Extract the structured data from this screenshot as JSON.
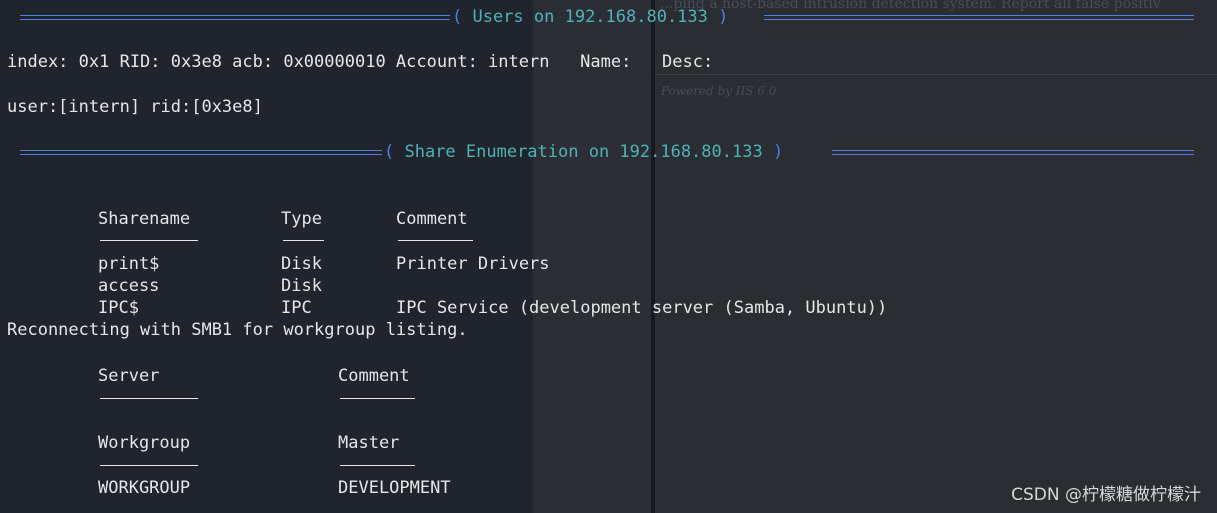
{
  "background_window": {
    "line1": "...ping a host-based intrusion detection system. Report all false positiv",
    "line2": "Powered by IIS 6.0"
  },
  "sections": {
    "users_heading": "Users on 192.168.80.133",
    "users_line": "index: 0x1 RID: 0x3e8 acb: 0x00000010 Account: intern   Name:   Desc:",
    "user_rid_line": "user:[intern] rid:[0x3e8]",
    "share_heading": "Share Enumeration on 192.168.80.133"
  },
  "share_table": {
    "headers": [
      "Sharename",
      "Type",
      "Comment"
    ],
    "rows": [
      {
        "sharename": "print$",
        "type": "Disk",
        "comment": "Printer Drivers"
      },
      {
        "sharename": "access",
        "type": "Disk",
        "comment": ""
      },
      {
        "sharename": "IPC$",
        "type": "IPC",
        "comment": "IPC Service (development server (Samba, Ubuntu))"
      }
    ]
  },
  "reconnect_line": "Reconnecting with SMB1 for workgroup listing.",
  "server_table": {
    "headers": [
      "Server",
      "Comment"
    ]
  },
  "workgroup_table": {
    "headers": [
      "Workgroup",
      "Master"
    ],
    "rows": [
      {
        "workgroup": "WORKGROUP",
        "master": "DEVELOPMENT"
      }
    ]
  },
  "watermark": "CSDN @柠檬糖做柠檬汁",
  "colors": {
    "heading_text": "#4fb3b5",
    "ruler": "#4f7ee8",
    "terminal_bg": "#1f242d",
    "text": "#e6e6e6"
  }
}
